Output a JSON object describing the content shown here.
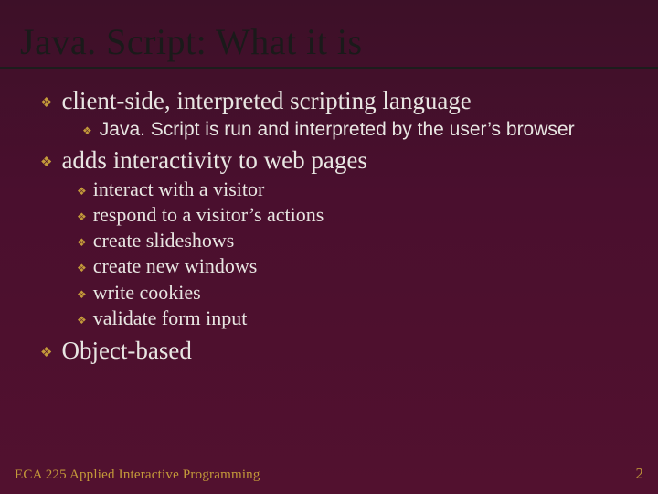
{
  "title": "Java. Script: What it is",
  "bullets": {
    "b1": {
      "text": "client-side, interpreted scripting language",
      "sub": {
        "s1": "Java. Script is run and interpreted by the user’s browser"
      }
    },
    "b2": {
      "text": "adds interactivity to web pages",
      "sub": {
        "s1": "interact with a visitor",
        "s2": "respond to a visitor’s actions",
        "s3": "create slideshows",
        "s4": "create new windows",
        "s5": "write cookies",
        "s6": "validate form input"
      }
    },
    "b3": {
      "text": "Object-based"
    }
  },
  "footer": {
    "course": "ECA 225   Applied Interactive Programming",
    "page": "2"
  },
  "glyphs": {
    "diamond": "❖"
  }
}
